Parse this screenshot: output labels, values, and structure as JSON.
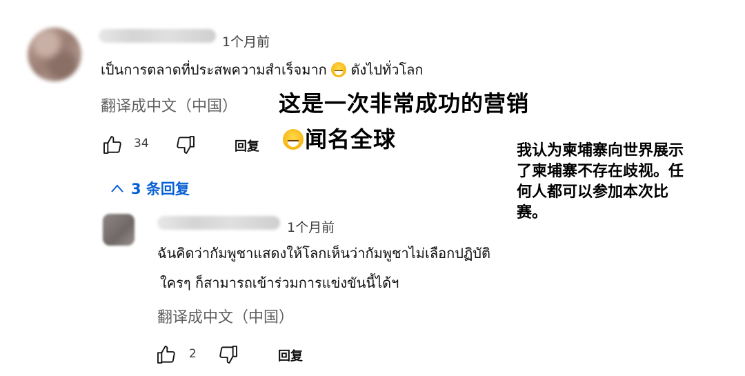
{
  "comment": {
    "timestamp": "1个月前",
    "text": "เป็นการตลาดที่ประสพความสำเร็จมาก",
    "text_tail": "ดังไปทั่วโลก",
    "translate_label": "翻译成中文（中国）",
    "likes": "34",
    "reply_label": "回复",
    "overlay_translation_line1": "这是一次非常成功的营销",
    "overlay_translation_line2": "闻名全球"
  },
  "replies_toggle": {
    "label": "3 条回复",
    "icon": "chevron-up-icon"
  },
  "reply": {
    "timestamp": "1个月前",
    "text_line1": "ฉันคิดว่ากัมพูชาแสดงให้โลกเห็นว่ากัมพูชาไม่เลือกปฏิบัติ",
    "text_line2": "ใครๆ ก็สามารถเข้าร่วมการแข่งขันนี้ได้ฯ",
    "translate_label": "翻译成中文（中国）",
    "likes": "2",
    "reply_label": "回复"
  },
  "side_note": {
    "line1": "我认为柬埔寨向世界展示",
    "line2": "了柬埔寨不存在歧视。任",
    "line3": "何人都可以参加本次比",
    "line4": "赛。"
  },
  "colors": {
    "link_blue": "#065fd4",
    "secondary_text": "#606060"
  }
}
